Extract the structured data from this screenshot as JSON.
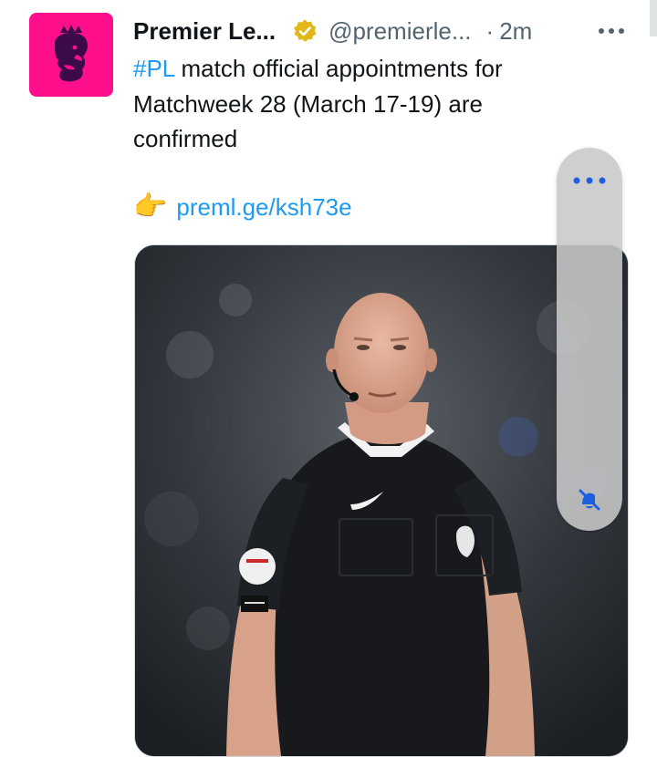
{
  "tweet": {
    "author_name": "Premier Le...",
    "handle": "@premierle...",
    "separator": "·",
    "time": "2m",
    "text_hashtag": "#PL",
    "text_body": " match official appointments for Matchweek 28 (March 17-19) are confirmed",
    "pointer_emoji": "👉",
    "link": "preml.ge/ksh73e"
  },
  "icons": {
    "avatar": "premier-league-lion-logo",
    "verified": "verified-badge-icon",
    "more": "more-options-icon",
    "panel_more": "panel-more-icon",
    "mute": "notifications-off-icon"
  },
  "colors": {
    "brand_pink": "#ff0f8c",
    "link_blue": "#1d9bf0",
    "verified_gold": "#e2b719",
    "text_dark": "#0f1419",
    "text_gray": "#536471"
  }
}
